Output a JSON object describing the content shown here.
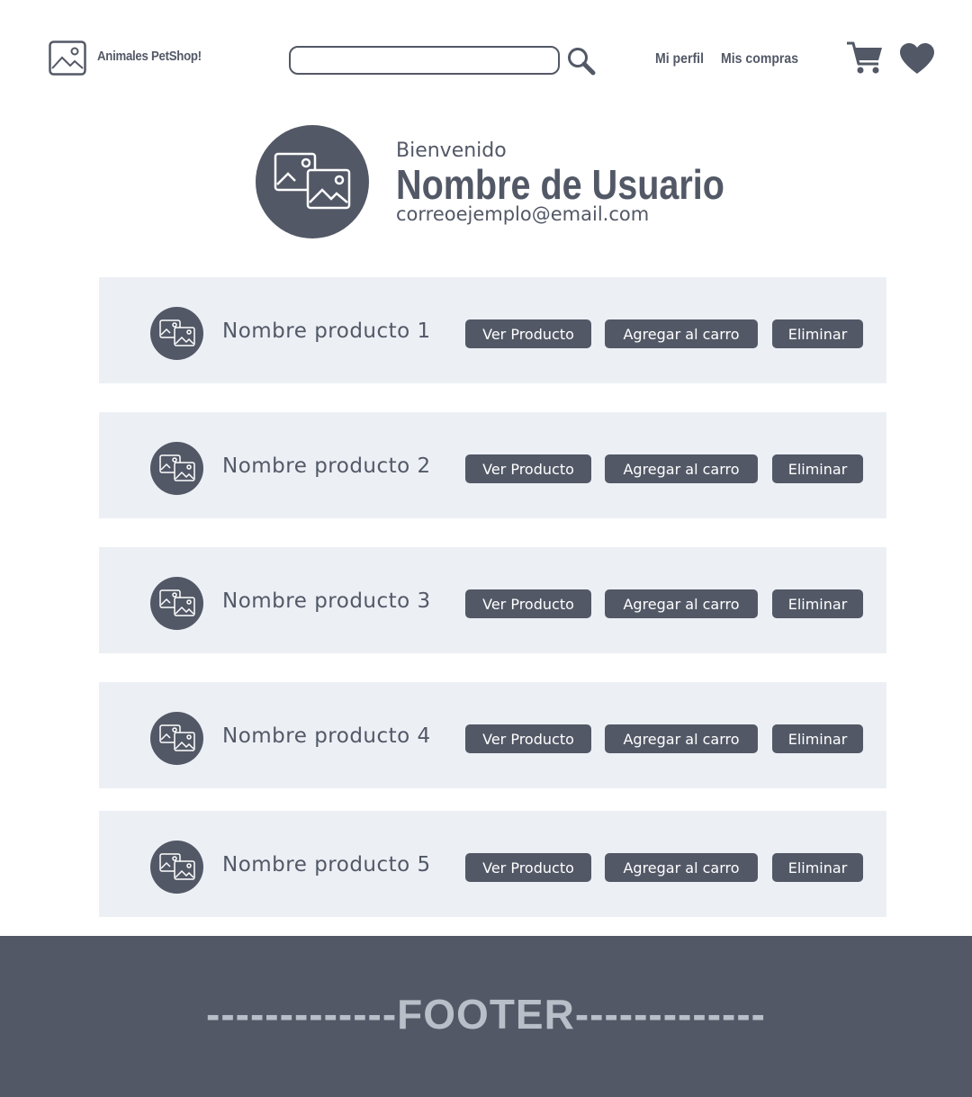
{
  "header": {
    "brand": "Animales PetShop!",
    "search": {
      "value": "",
      "placeholder": ""
    },
    "nav": {
      "profile": "Mi perfil",
      "purchases": "Mis compras"
    }
  },
  "profile": {
    "welcome": "Bienvenido",
    "username": "Nombre de Usuario",
    "email": "correoejemplo@email.com"
  },
  "products": [
    {
      "name": "Nombre producto 1",
      "view": "Ver Producto",
      "add": "Agregar al carro",
      "remove": "Eliminar"
    },
    {
      "name": "Nombre producto 2",
      "view": "Ver Producto",
      "add": "Agregar al carro",
      "remove": "Eliminar"
    },
    {
      "name": "Nombre producto 3",
      "view": "Ver Producto",
      "add": "Agregar al carro",
      "remove": "Eliminar"
    },
    {
      "name": "Nombre producto 4",
      "view": "Ver Producto",
      "add": "Agregar al carro",
      "remove": "Eliminar"
    },
    {
      "name": "Nombre producto 5",
      "view": "Ver Producto",
      "add": "Agregar al carro",
      "remove": "Eliminar"
    }
  ],
  "footer": {
    "text": "-------------FOOTER-------------"
  },
  "icons": {
    "logo": "image-icon",
    "search": "magnifier-icon",
    "cart": "cart-icon",
    "favorites": "heart-icon",
    "avatar": "images-icon"
  },
  "colors": {
    "primary": "#525866",
    "row_bg": "#ecf0f5",
    "footer_text": "#b9bfc8"
  }
}
